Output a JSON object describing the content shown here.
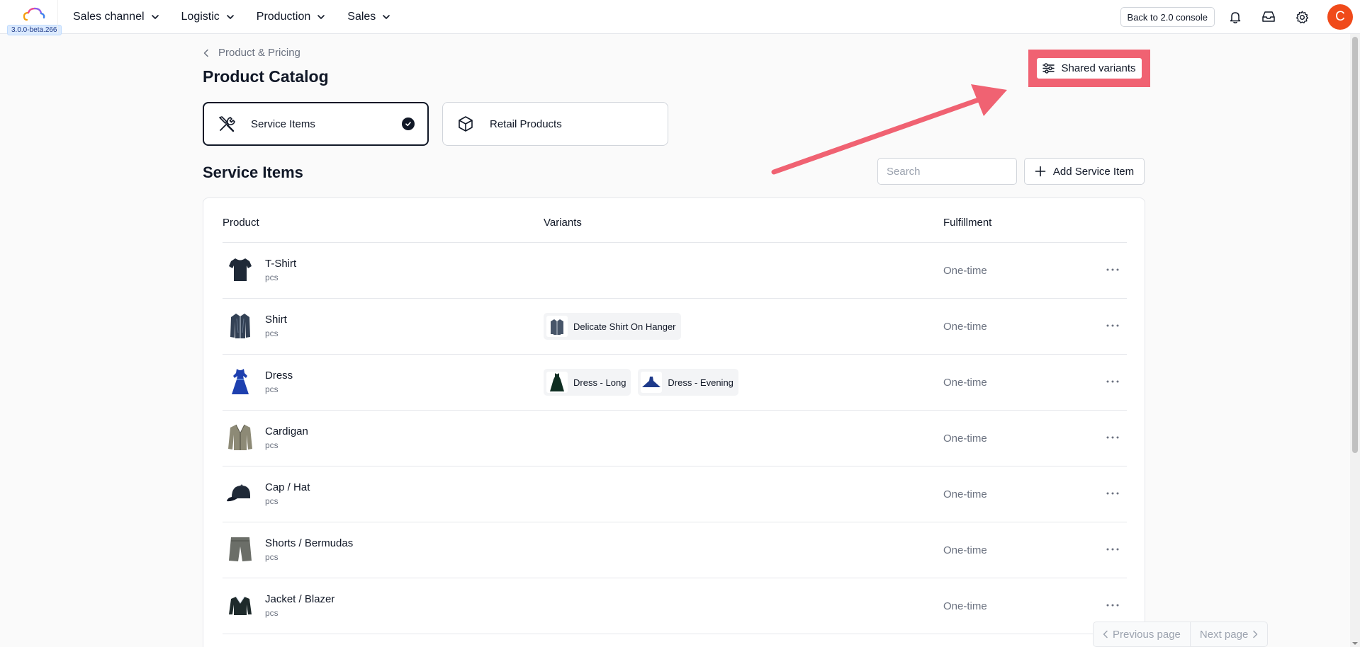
{
  "app": {
    "version": "3.0.0-beta.266",
    "nav": [
      {
        "label": "Sales channel"
      },
      {
        "label": "Logistic"
      },
      {
        "label": "Production"
      },
      {
        "label": "Sales"
      }
    ],
    "back_label": "Back to 2.0 console",
    "avatar_initial": "C",
    "colors": {
      "avatar": "#f04a1a",
      "highlight": "#f06272"
    }
  },
  "header": {
    "breadcrumb": "Product & Pricing",
    "title": "Product Catalog",
    "shared_variants_label": "Shared variants"
  },
  "type_tabs": [
    {
      "label": "Service Items",
      "icon": "tools-icon",
      "selected": true
    },
    {
      "label": "Retail Products",
      "icon": "box-icon",
      "selected": false
    }
  ],
  "section": {
    "title": "Service Items",
    "search_placeholder": "Search",
    "add_label": "Add Service Item"
  },
  "table": {
    "columns": [
      "Product",
      "Variants",
      "Fulfillment"
    ],
    "rows": [
      {
        "name": "T-Shirt",
        "unit": "pcs",
        "variants": [],
        "fulfillment": "One-time"
      },
      {
        "name": "Shirt",
        "unit": "pcs",
        "variants": [
          {
            "label": "Delicate Shirt On Hanger"
          }
        ],
        "fulfillment": "One-time"
      },
      {
        "name": "Dress",
        "unit": "pcs",
        "variants": [
          {
            "label": "Dress - Long"
          },
          {
            "label": "Dress - Evening"
          }
        ],
        "fulfillment": "One-time"
      },
      {
        "name": "Cardigan",
        "unit": "pcs",
        "variants": [],
        "fulfillment": "One-time"
      },
      {
        "name": "Cap / Hat",
        "unit": "pcs",
        "variants": [],
        "fulfillment": "One-time"
      },
      {
        "name": "Shorts / Bermudas",
        "unit": "pcs",
        "variants": [],
        "fulfillment": "One-time"
      },
      {
        "name": "Jacket / Blazer",
        "unit": "pcs",
        "variants": [],
        "fulfillment": "One-time"
      }
    ]
  },
  "pagination": {
    "previous_label": "Previous page",
    "next_label": "Next page"
  }
}
